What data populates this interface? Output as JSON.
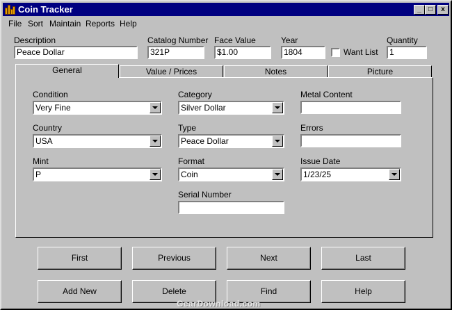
{
  "window": {
    "title": "Coin Tracker",
    "minimize": "_",
    "maximize": "□",
    "close": "x"
  },
  "menu": [
    {
      "label": "File"
    },
    {
      "label": "Sort"
    },
    {
      "label": "Maintain"
    },
    {
      "label": "Reports"
    },
    {
      "label": "Help"
    }
  ],
  "header_fields": {
    "description": {
      "label": "Description",
      "value": "Peace Dollar"
    },
    "catalog_number": {
      "label": "Catalog Number",
      "value": "321P"
    },
    "face_value": {
      "label": "Face Value",
      "value": "$1.00"
    },
    "year": {
      "label": "Year",
      "value": "1804"
    },
    "want_list": {
      "label": "Want List",
      "checked": false
    },
    "quantity": {
      "label": "Quantity",
      "value": "1"
    }
  },
  "tabs": [
    {
      "label": "General",
      "active": true
    },
    {
      "label": "Value / Prices"
    },
    {
      "label": "Notes"
    },
    {
      "label": "Picture"
    }
  ],
  "general": {
    "condition": {
      "label": "Condition",
      "value": "Very Fine"
    },
    "country": {
      "label": "Country",
      "value": "USA"
    },
    "mint": {
      "label": "Mint",
      "value": "P"
    },
    "category": {
      "label": "Category",
      "value": "Silver Dollar"
    },
    "type": {
      "label": "Type",
      "value": "Peace Dollar"
    },
    "format": {
      "label": "Format",
      "value": "Coin"
    },
    "serial_number": {
      "label": "Serial Number",
      "value": ""
    },
    "metal_content": {
      "label": "Metal Content",
      "value": ""
    },
    "errors": {
      "label": "Errors",
      "value": ""
    },
    "issue_date": {
      "label": "Issue Date",
      "value": "1/23/25"
    }
  },
  "buttons": {
    "first": "First",
    "previous": "Previous",
    "next": "Next",
    "last": "Last",
    "add_new": "Add New",
    "delete": "Delete",
    "find": "Find",
    "help": "Help"
  },
  "watermark": "GearDownload.com"
}
